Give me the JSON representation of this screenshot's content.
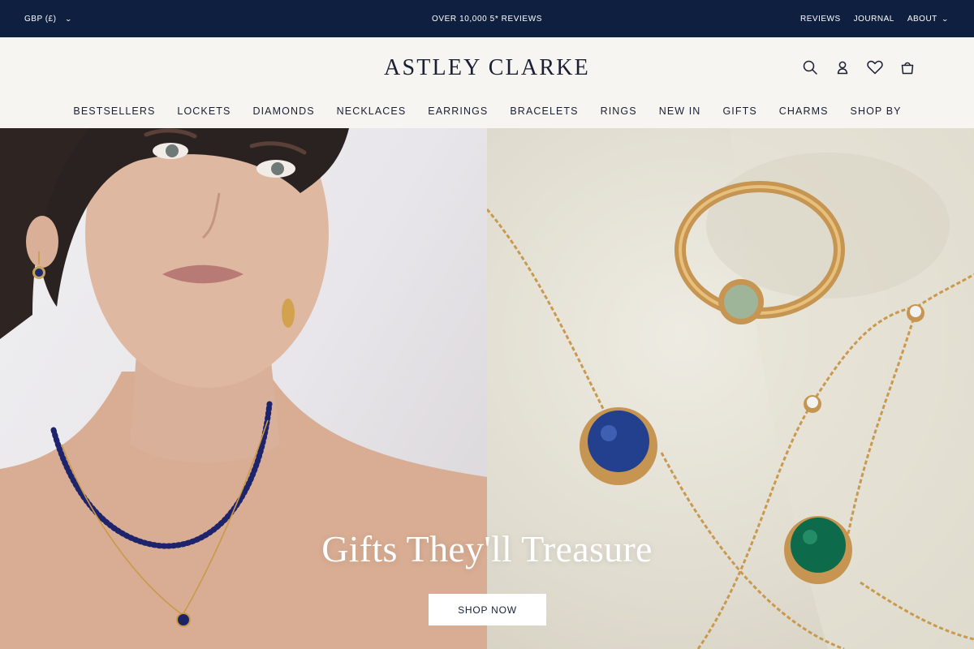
{
  "topbar": {
    "currency": "GBP (£)",
    "promo": "OVER 10,000 5* REVIEWS",
    "links": [
      "REVIEWS",
      "JOURNAL",
      "ABOUT"
    ]
  },
  "header": {
    "logo": "ASTLEY CLARKE",
    "icons": [
      "search-icon",
      "account-icon",
      "wishlist-heart-icon",
      "bag-icon"
    ]
  },
  "nav": {
    "items": [
      "BESTSELLERS",
      "LOCKETS",
      "DIAMONDS",
      "NECKLACES",
      "EARRINGS",
      "BRACELETS",
      "RINGS",
      "NEW IN",
      "GIFTS",
      "CHARMS",
      "SHOP BY"
    ]
  },
  "hero": {
    "headline": "Gifts They'll Treasure",
    "cta": "SHOP NOW"
  },
  "colors": {
    "topbar_bg": "#0f1f3f",
    "header_bg": "#f7f5f1",
    "text": "#1a1f33",
    "cta_bg": "#ffffff"
  }
}
